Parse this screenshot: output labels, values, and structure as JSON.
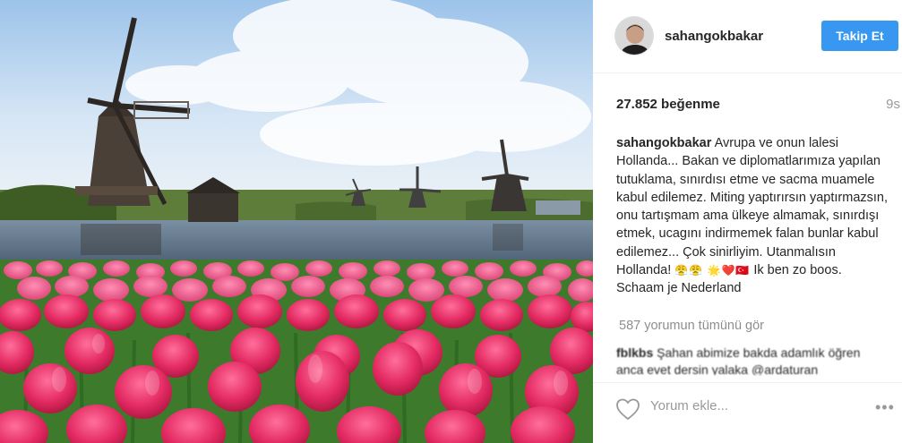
{
  "post": {
    "photo_icon": "windmills-tulips-photo"
  },
  "header": {
    "username": "sahangokbakar",
    "follow_label": "Takip Et"
  },
  "stats": {
    "likes": "27.852 beğenme",
    "time": "9s"
  },
  "caption": {
    "username": "sahangokbakar",
    "text": "Avrupa ve onun lalesi Hollanda... Bakan ve diplomatlarımıza yapılan tutuklama, sınırdısı etme ve sacma muamele kabul edilemez. Miting yaptırırsın yaptırmazsın, onu tartışmam ama ülkeye almamak, sınırdışı etmek, ucagını indirmemek falan bunlar kabul edilemez... Çok sinirliyim. Utanmalısın Hollanda!",
    "emojis": "😤😤 🌟❤️🇹🇷",
    "text_end": "Ik ben zo boos. Schaam je Nederland"
  },
  "comments": {
    "view_all": "587 yorumun tümünü gör",
    "first_username": "fblkbs",
    "first_text": "Şahan abimize bakda adamlık öğren anca evet dersin yalaka @ardaturan"
  },
  "footer": {
    "comment_placeholder": "Yorum ekle...",
    "more_label": "•••"
  },
  "colors": {
    "follow": "#3897f0",
    "meta": "#999999"
  }
}
